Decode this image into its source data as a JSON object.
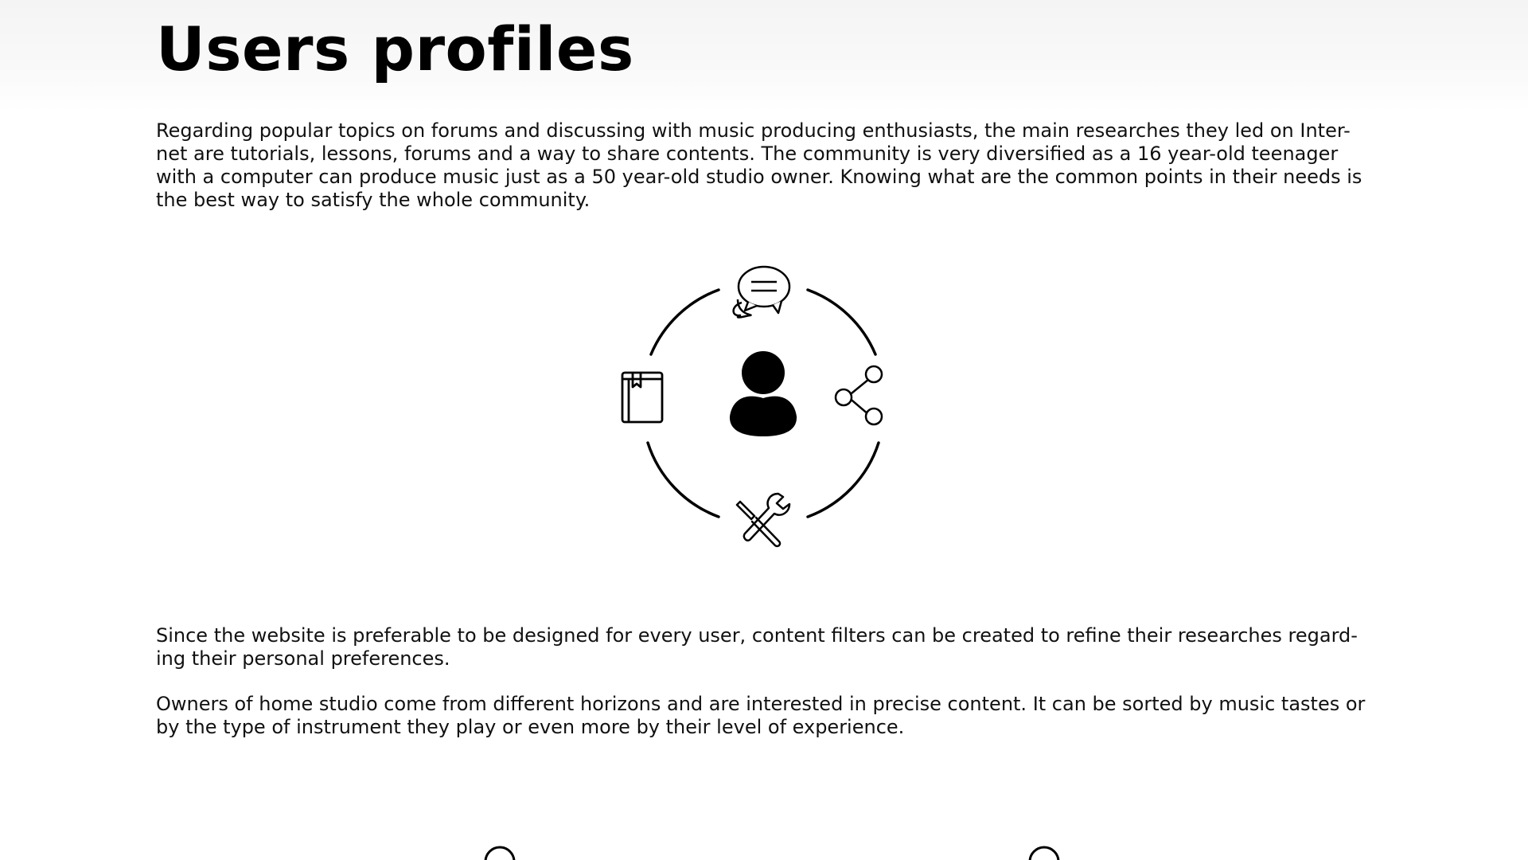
{
  "page": {
    "title": "Users profiles",
    "paragraphs": [
      "Regarding popular topics on forums and discussing with music producing enthusiasts, the main researches they led on Inter-net are tutorials, lessons, forums and a way to share contents. The community is very diversified as a 16 year-old teenager with a computer can produce music just as a 50 year-old studio owner. Knowing what are the common points in their needs is the best way to satisfy the whole community.",
      "Since the website is preferable to be designed for every user, content filters can be created to refine their researches regard-ing their personal preferences.",
      "Owners of home studio come from different horizons and are interested in precise content. It can be sorted by music tastes or by the type of instrument they play or even more by their level of experience."
    ]
  },
  "diagram": {
    "center_icon": "user-icon",
    "top_icon": "chat-bubbles-icon",
    "left_icon": "book-icon",
    "right_icon": "share-icon",
    "bottom_icon": "tools-icon",
    "stroke_color": "#000000"
  }
}
